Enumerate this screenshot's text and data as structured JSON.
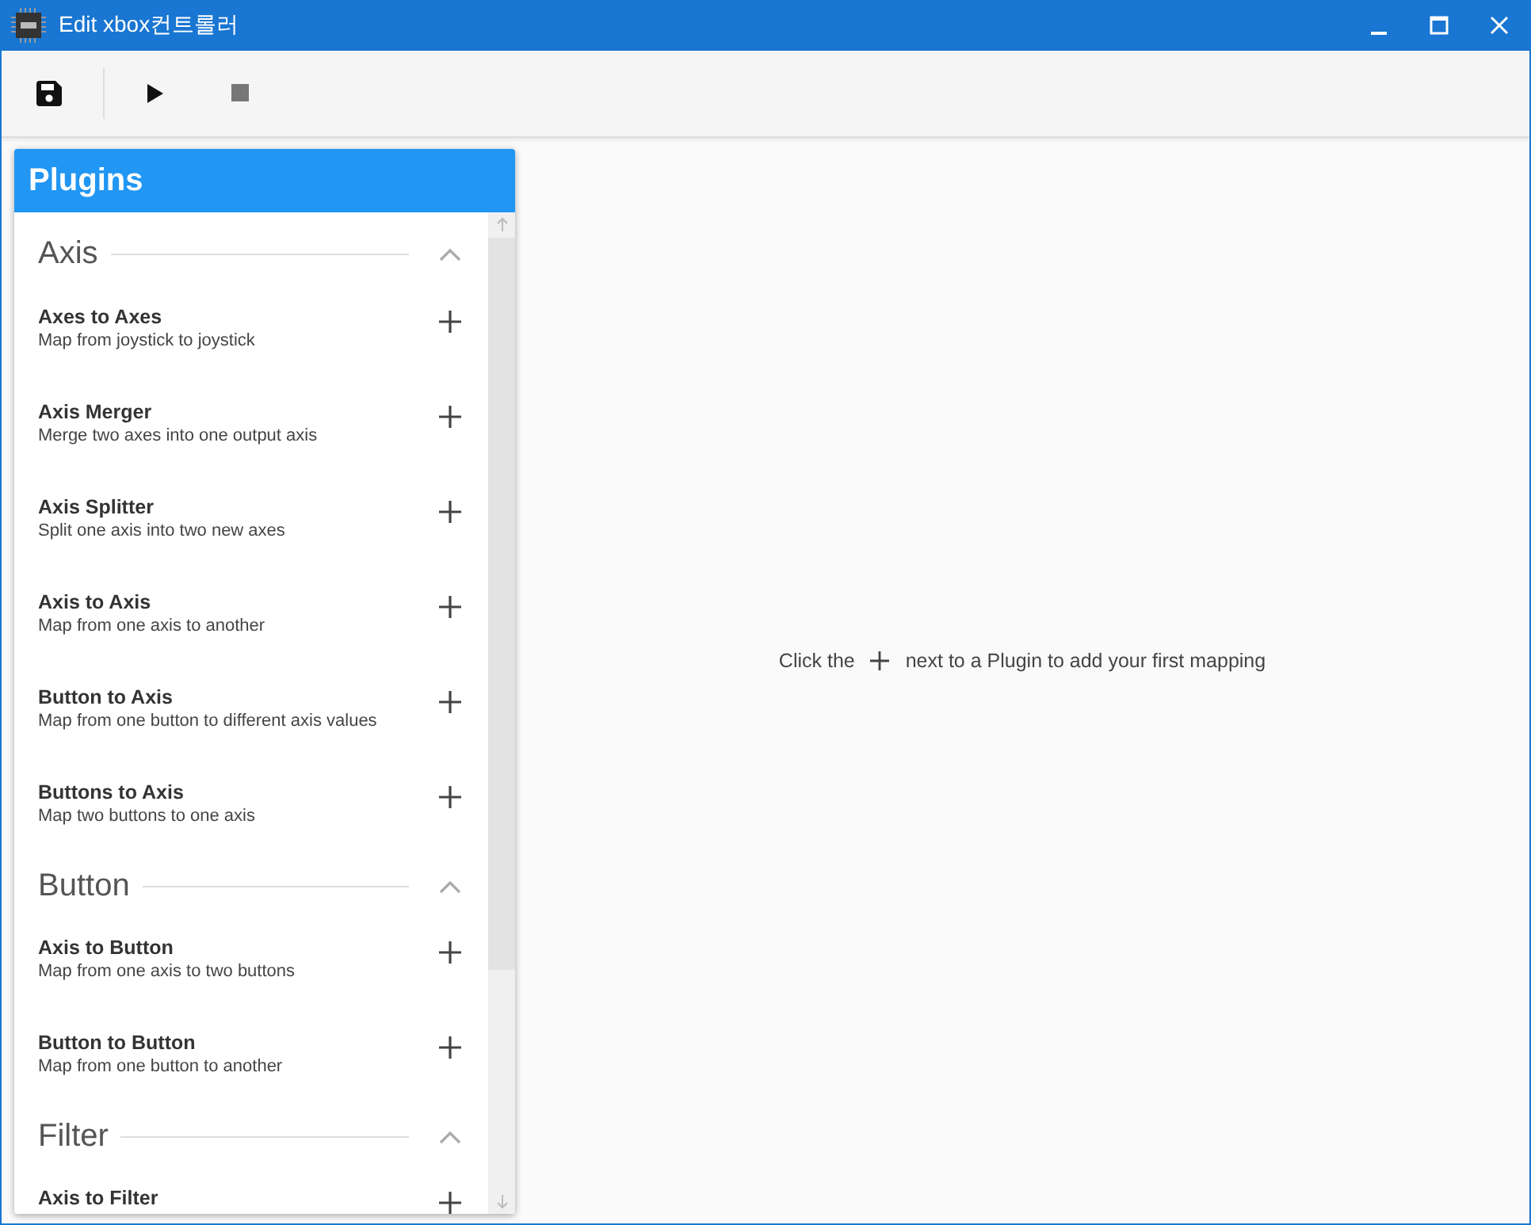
{
  "window": {
    "title": "Edit xbox컨트롤러"
  },
  "panel": {
    "title": "Plugins",
    "sections": [
      {
        "title": "Axis",
        "expanded": true,
        "plugins": [
          {
            "name": "Axes to Axes",
            "description": "Map from joystick to joystick"
          },
          {
            "name": "Axis Merger",
            "description": "Merge two axes into one output axis"
          },
          {
            "name": "Axis Splitter",
            "description": "Split one axis into two new axes"
          },
          {
            "name": "Axis to Axis",
            "description": "Map from one axis to another"
          },
          {
            "name": "Button to Axis",
            "description": "Map from one button to different axis values"
          },
          {
            "name": "Buttons to Axis",
            "description": "Map two buttons to one axis"
          }
        ]
      },
      {
        "title": "Button",
        "expanded": true,
        "plugins": [
          {
            "name": "Axis to Button",
            "description": "Map from one axis to two buttons"
          },
          {
            "name": "Button to Button",
            "description": "Map from one button to another"
          }
        ]
      },
      {
        "title": "Filter",
        "expanded": true,
        "plugins": [
          {
            "name": "Axis to Filter"
          }
        ]
      }
    ]
  },
  "empty_message": {
    "before": "Click the",
    "after": "next to a Plugin to add your first mapping"
  }
}
